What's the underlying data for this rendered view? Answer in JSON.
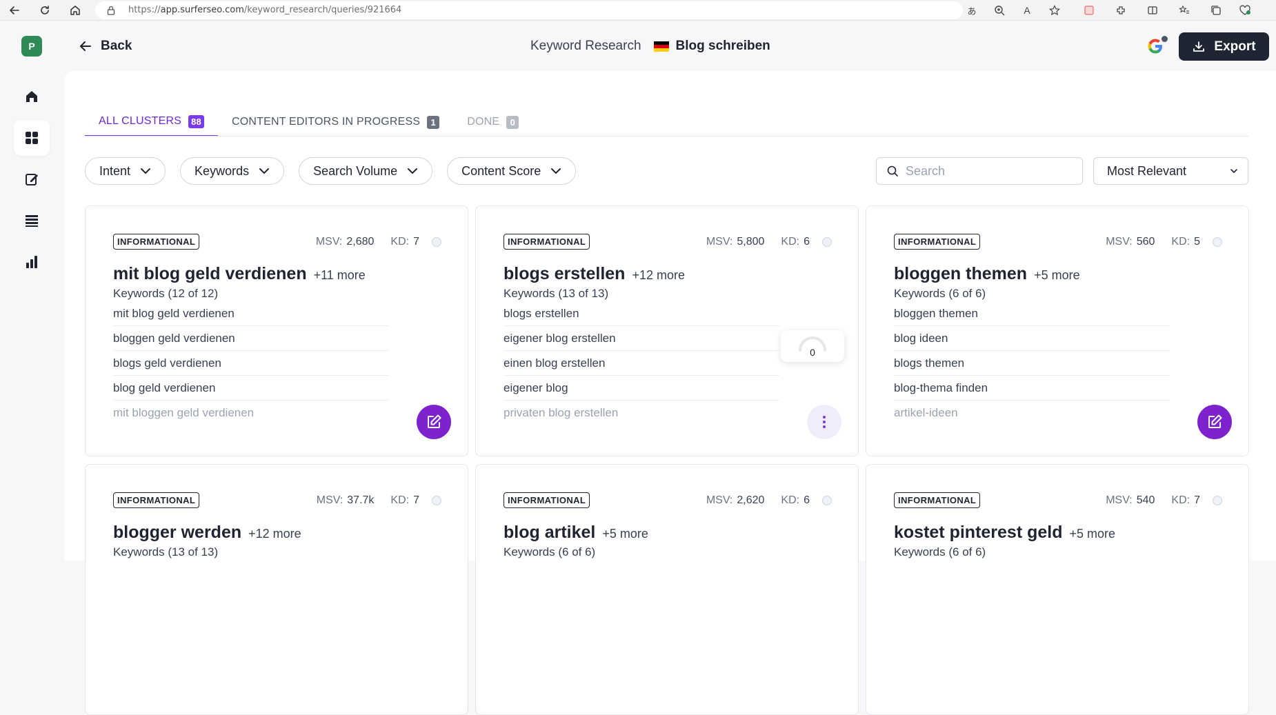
{
  "browser": {
    "url_prefix": "https://",
    "url_host": "app.surferseo.com",
    "url_path": "/keyword_research/queries/921664",
    "icons": [
      "back-arrow-icon",
      "refresh-icon",
      "home-icon",
      "lock-icon",
      "translate-icon",
      "zoom-icon",
      "read-aloud-icon",
      "favorite-star-icon",
      "pdf-extension-icon",
      "extensions-icon",
      "split-screen-icon",
      "favorites-icon",
      "collections-icon",
      "browser-health-icon"
    ]
  },
  "header": {
    "avatar_letter": "P",
    "back_label": "Back",
    "section_title": "Keyword Research",
    "project_name": "Blog schreiben",
    "export_label": "Export"
  },
  "tabs": [
    {
      "label": "ALL CLUSTERS",
      "count": "88"
    },
    {
      "label": "CONTENT EDITORS IN PROGRESS",
      "count": "1"
    },
    {
      "label": "DONE",
      "count": "0"
    }
  ],
  "filters": {
    "intent": "Intent",
    "keywords": "Keywords",
    "search_volume": "Search Volume",
    "content_score": "Content Score"
  },
  "search": {
    "placeholder": "Search",
    "value": ""
  },
  "sort": {
    "selected": "Most Relevant"
  },
  "metric_labels": {
    "msv": "MSV:",
    "kd": "KD:"
  },
  "cards": [
    {
      "intent": "INFORMATIONAL",
      "msv": "2,680",
      "kd": "7",
      "title": "mit blog geld verdienen",
      "more": "+11 more",
      "keywords_count": "Keywords (12 of 12)",
      "keywords": [
        "mit blog geld verdienen",
        "bloggen geld verdienen",
        "blogs geld verdienen",
        "blog geld verdienen",
        "mit bloggen geld verdienen"
      ],
      "action": "edit"
    },
    {
      "intent": "INFORMATIONAL",
      "msv": "5,800",
      "kd": "6",
      "title": "blogs erstellen",
      "more": "+12 more",
      "keywords_count": "Keywords (13 of 13)",
      "keywords": [
        "blogs erstellen",
        "eigener blog erstellen",
        "einen blog erstellen",
        "eigener blog",
        "privaten blog erstellen"
      ],
      "action": "more",
      "content_score": "0"
    },
    {
      "intent": "INFORMATIONAL",
      "msv": "560",
      "kd": "5",
      "title": "bloggen themen",
      "more": "+5 more",
      "keywords_count": "Keywords (6 of 6)",
      "keywords": [
        "bloggen themen",
        "blog ideen",
        "blogs themen",
        "blog-thema finden",
        "artikel-ideen"
      ],
      "action": "edit"
    },
    {
      "intent": "INFORMATIONAL",
      "msv": "37.7k",
      "kd": "7",
      "title": "blogger werden",
      "more": "+12 more",
      "keywords_count": "Keywords (13 of 13)"
    },
    {
      "intent": "INFORMATIONAL",
      "msv": "2,620",
      "kd": "6",
      "title": "blog artikel",
      "more": "+5 more",
      "keywords_count": "Keywords (6 of 6)"
    },
    {
      "intent": "INFORMATIONAL",
      "msv": "540",
      "kd": "7",
      "title": "kostet pinterest geld",
      "more": "+5 more",
      "keywords_count": "Keywords (6 of 6)"
    }
  ]
}
